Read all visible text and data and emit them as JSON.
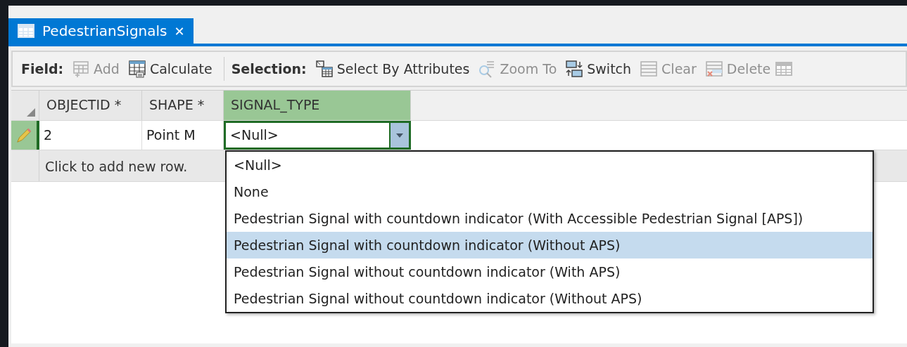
{
  "tab": {
    "title": "PedestrianSignals",
    "close": "✕",
    "selected": true
  },
  "toolbar": {
    "groups": [
      {
        "label": "Field:",
        "buttons": [
          {
            "kind": "add",
            "label": "Add",
            "disabled": true
          },
          {
            "kind": "calculate",
            "label": "Calculate",
            "disabled": false
          }
        ]
      },
      {
        "label": "Selection:",
        "buttons": [
          {
            "kind": "select",
            "label": "Select By Attributes",
            "disabled": false
          },
          {
            "kind": "zoom",
            "label": "Zoom To",
            "disabled": true
          },
          {
            "kind": "switch",
            "label": "Switch",
            "disabled": false
          },
          {
            "kind": "clear",
            "label": "Clear",
            "disabled": true
          },
          {
            "kind": "delete",
            "label": "Delete",
            "disabled": true
          }
        ]
      }
    ]
  },
  "table": {
    "columns": [
      {
        "label": "OBJECTID *",
        "selected": false
      },
      {
        "label": "SHAPE *",
        "selected": false
      },
      {
        "label": "SIGNAL_TYPE",
        "selected": true
      }
    ],
    "rows": [
      {
        "editing": true,
        "cells": [
          "2",
          "Point M",
          "<Null>"
        ]
      }
    ],
    "new_row": "Click to add new row."
  },
  "dropdown": {
    "options": [
      {
        "label": "<Null>",
        "selected": false
      },
      {
        "label": "None",
        "selected": false
      },
      {
        "label": "Pedestrian Signal with countdown indicator (With Accessible Pedestrian Signal [APS])",
        "selected": false
      },
      {
        "label": "Pedestrian Signal with countdown indicator (Without APS)",
        "selected": true
      },
      {
        "label": "Pedestrian Signal without countdown indicator (With APS)",
        "selected": false
      },
      {
        "label": "Pedestrian Signal without countdown indicator (Without APS)",
        "selected": false
      }
    ]
  }
}
